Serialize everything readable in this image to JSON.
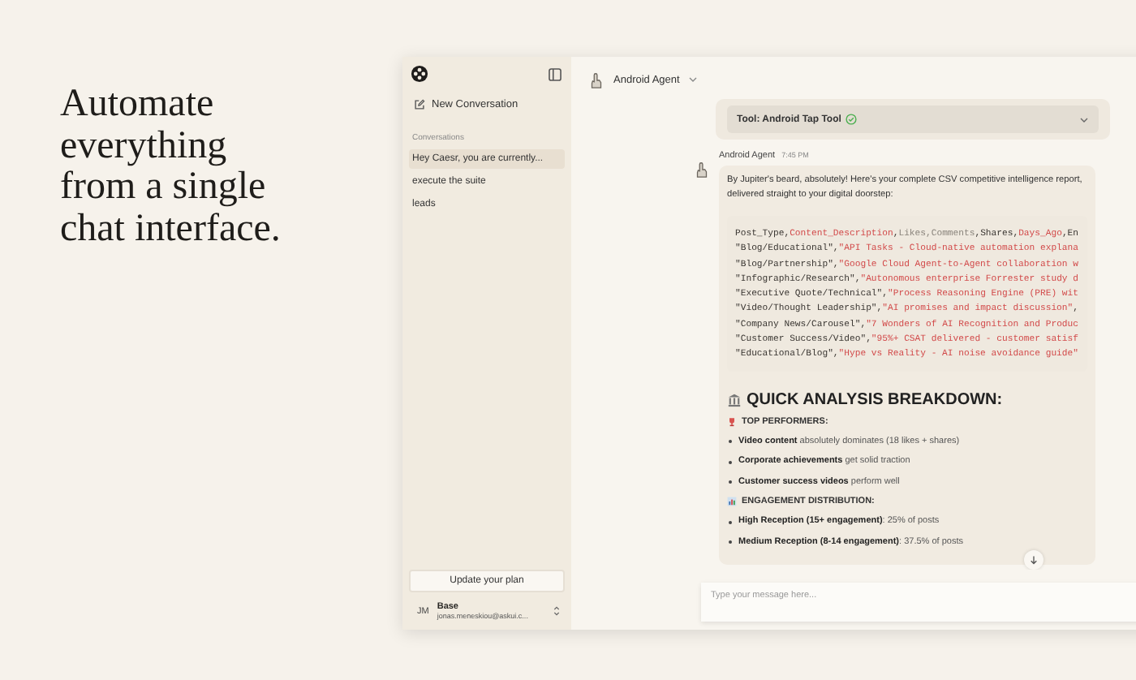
{
  "headline": "Automate\neverything\nfrom a single\nchat interface.",
  "sidebar": {
    "new_conversation": "New Conversation",
    "section_label": "Conversations",
    "conversations": [
      {
        "title": "Hey Caesr, you are currently...",
        "selected": true
      },
      {
        "title": "execute the suite",
        "selected": false
      },
      {
        "title": "leads",
        "selected": false
      }
    ],
    "upgrade_button": "Update your plan",
    "user": {
      "initials": "JM",
      "plan": "Base",
      "email": "jonas.meneskiou@askui.c..."
    }
  },
  "header": {
    "agent_name": "Android Agent"
  },
  "tool_card": {
    "label": "Tool: Android Tap Tool",
    "expanded": false
  },
  "message": {
    "sender": "Android Agent",
    "time": "7:45 PM",
    "intro": "By Jupiter's beard, absolutely! Here's your complete CSV competitive intelligence report, delivered straight to your digital doorstep:",
    "code_lines": [
      [
        {
          "text": "Post_Type,",
          "kind": "plain"
        },
        {
          "text": "Content_Description",
          "kind": "red"
        },
        {
          "text": ",",
          "kind": "plain"
        },
        {
          "text": "Likes,Comments",
          "kind": "muted"
        },
        {
          "text": ",Shares,",
          "kind": "plain"
        },
        {
          "text": "Days_Ago",
          "kind": "red"
        },
        {
          "text": ",En",
          "kind": "plain"
        }
      ],
      [
        {
          "text": "\"Blog/Educational\",",
          "kind": "plain"
        },
        {
          "text": "\"API Tasks - Cloud-native automation explana",
          "kind": "red"
        }
      ],
      [
        {
          "text": "\"Blog/Partnership\",",
          "kind": "plain"
        },
        {
          "text": "\"Google Cloud Agent-to-Agent collaboration w",
          "kind": "red"
        }
      ],
      [
        {
          "text": "\"Infographic/Research\",",
          "kind": "plain"
        },
        {
          "text": "\"Autonomous enterprise Forrester study d",
          "kind": "red"
        }
      ],
      [
        {
          "text": "\"Executive Quote/Technical\",",
          "kind": "plain"
        },
        {
          "text": "\"Process Reasoning Engine (PRE) wit",
          "kind": "red"
        }
      ],
      [
        {
          "text": "\"Video/Thought Leadership\",",
          "kind": "plain"
        },
        {
          "text": "\"AI promises and impact discussion\"",
          "kind": "red"
        },
        {
          "text": ",",
          "kind": "plain"
        }
      ],
      [
        {
          "text": "\"Company News/Carousel\",",
          "kind": "plain"
        },
        {
          "text": "\"7 Wonders of AI Recognition and Produc",
          "kind": "red"
        }
      ],
      [
        {
          "text": "\"Customer Success/Video\",",
          "kind": "plain"
        },
        {
          "text": "\"95%+ CSAT delivered - customer satisf",
          "kind": "red"
        }
      ],
      [
        {
          "text": "\"Educational/Blog\",",
          "kind": "plain"
        },
        {
          "text": "\"Hype vs Reality - AI noise avoidance guide\"",
          "kind": "red"
        }
      ]
    ],
    "sections": [
      {
        "kind": "heading",
        "text": "QUICK ANALYSIS BREAKDOWN:"
      },
      {
        "kind": "subheading",
        "text": "TOP PERFORMERS:"
      },
      {
        "kind": "bullets",
        "items": [
          "**Video content** absolutely dominates (18 likes + shares)",
          "**Corporate achievements** get solid traction",
          "**Customer success videos** perform well"
        ]
      },
      {
        "kind": "subheading",
        "text": "ENGAGEMENT DISTRIBUTION:"
      },
      {
        "kind": "bullets",
        "items": [
          "**High Reception (15+ engagement)**: 25% of posts",
          "**Medium Reception (8-14 engagement)**: 37.5% of posts"
        ]
      }
    ]
  },
  "composer": {
    "placeholder": "Type your message here..."
  }
}
